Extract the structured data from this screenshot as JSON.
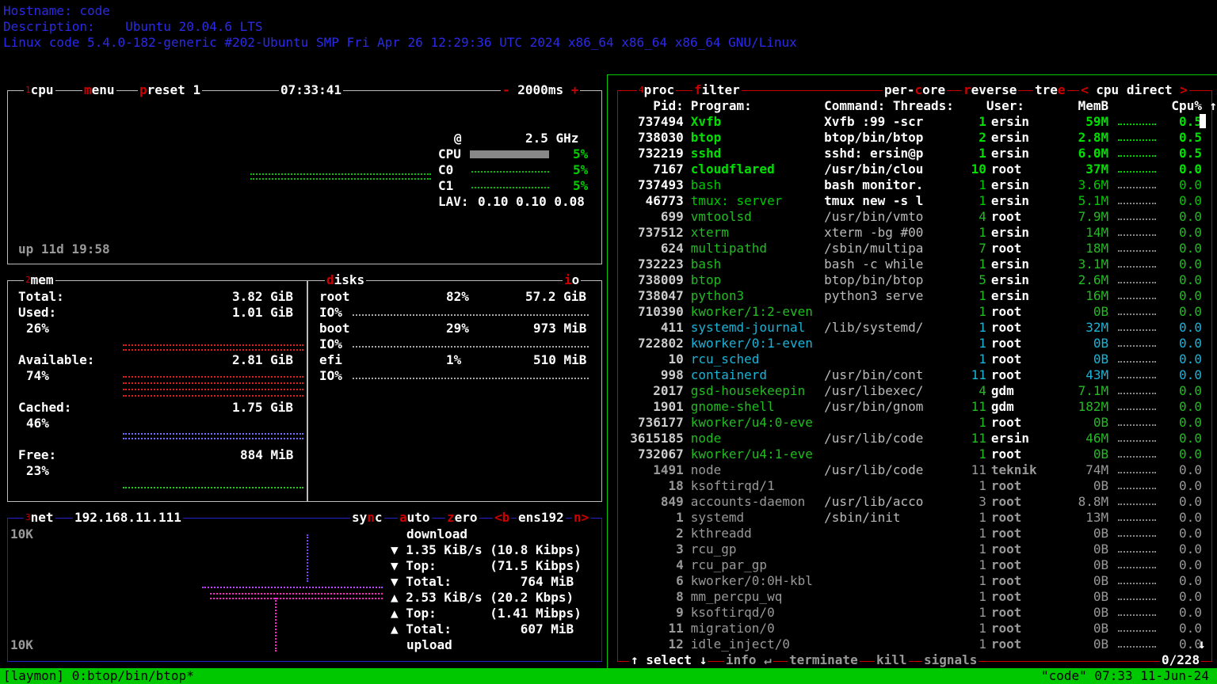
{
  "sysinfo": {
    "hostname": "Hostname: code",
    "description": "Description:    Ubuntu 20.04.6 LTS",
    "uname": "Linux code 5.4.0-182-generic #202-Ubuntu SMP Fri Apr 26 12:29:36 UTC 2024 x86_64 x86_64 x86_64 GNU/Linux"
  },
  "cpu": {
    "num": "1",
    "title": "cpu",
    "menu_key": "m",
    "menu_rest": "enu",
    "preset_key": "p",
    "preset_rest": "reset 1",
    "clock": "07:33:41",
    "minus": "-",
    "interval": "2000ms",
    "plus": "+",
    "freq_at": "@",
    "freq": "2.5 GHz",
    "rows": [
      {
        "label": "CPU",
        "pct": "5%",
        "fill": 1.0
      },
      {
        "label": "C0",
        "pct": "5%"
      },
      {
        "label": "C1",
        "pct": "5%"
      }
    ],
    "lav_label": "LAV:",
    "lav": "0.10 0.10 0.08",
    "uptime": "up 11d 19:58"
  },
  "mem": {
    "num": "2",
    "title": "mem",
    "total_label": "Total:",
    "total": "3.82 GiB",
    "used_label": "Used:",
    "used": "1.01 GiB",
    "used_pct": "26%",
    "avail_label": "Available:",
    "avail": "2.81 GiB",
    "avail_pct": "74%",
    "cached_label": "Cached:",
    "cached": "1.75 GiB",
    "cached_pct": "46%",
    "free_label": "Free:",
    "free": "884 MiB",
    "free_pct": "23%",
    "colors": {
      "used": "#e02020",
      "avail": "#e02020",
      "cached": "#6b6bff",
      "free": "#22cc22"
    }
  },
  "disks": {
    "key": "d",
    "title": "isks",
    "io_key": "i",
    "io_rest": "o",
    "items": [
      {
        "name": "root",
        "pct": "82%",
        "size": "57.2 GiB",
        "io": "IO%"
      },
      {
        "name": "boot",
        "pct": "29%",
        "size": "973 MiB",
        "io": "IO%"
      },
      {
        "name": "efi",
        "pct": "1%",
        "size": "510 MiB",
        "io": "IO%"
      }
    ]
  },
  "net": {
    "num": "3",
    "title": "net",
    "ip": "192.168.11.111",
    "sync_pre": "sy",
    "sync_key": "n",
    "sync_post": "c",
    "auto_key": "a",
    "auto_rest": "uto",
    "zero_key": "z",
    "zero_rest": "ero",
    "b_key": "<b",
    "iface": "ens192",
    "n_key": "n>",
    "scale_top": "10K",
    "scale_bottom": "10K",
    "download": "download",
    "upload": "upload",
    "lines": [
      "▼ 1.35 KiB/s (10.8 Kibps)",
      "▼ Top:       (71.5 Kibps)",
      "▼ Total:         764 MiB",
      "▲ 2.53 KiB/s (20.2 Kbps)",
      "▲ Top:       (1.41 Mibps)",
      "▲ Total:         607 MiB"
    ]
  },
  "proc": {
    "num": "4",
    "title": "proc",
    "filter_key": "f",
    "filter_rest": "ilter",
    "percore_pre": "per-",
    "percore_key": "c",
    "percore_post": "ore",
    "reverse_key": "r",
    "reverse_rest": "everse",
    "tree_pre": "tre",
    "tree_key": "e",
    "sort_left": "<",
    "sort": "cpu direct",
    "sort_right": ">",
    "headers": {
      "pid": "Pid:",
      "program": "Program:",
      "command": "Command:",
      "threads": "Threads:",
      "user": "User:",
      "mem": "MemB",
      "cpu": "Cpu%",
      "arrow_up": "↑",
      "arrow_down": "↓"
    },
    "rows": [
      {
        "pid": "737494",
        "prog": "Xvfb",
        "cmd": "Xvfb :99 -scr",
        "thr": "1",
        "user": "ersin",
        "mem": "59M",
        "cpu": "0.5",
        "style": "hot"
      },
      {
        "pid": "738030",
        "prog": "btop",
        "cmd": "btop/bin/btop",
        "thr": "2",
        "user": "ersin",
        "mem": "2.8M",
        "cpu": "0.5",
        "style": "hot"
      },
      {
        "pid": "732219",
        "prog": "sshd",
        "cmd": "sshd: ersin@p",
        "thr": "1",
        "user": "ersin",
        "mem": "6.0M",
        "cpu": "0.5",
        "style": "hot"
      },
      {
        "pid": "7167",
        "prog": "cloudflared",
        "cmd": "/usr/bin/clou",
        "thr": "10",
        "user": "root",
        "mem": "37M",
        "cpu": "0.0",
        "style": "hot"
      },
      {
        "pid": "737493",
        "prog": "bash",
        "cmd": "bash monitor.",
        "thr": "1",
        "user": "ersin",
        "mem": "3.6M",
        "cpu": "0.0",
        "style": "warm"
      },
      {
        "pid": "46773",
        "prog": "tmux: server",
        "cmd": "tmux new -s l",
        "thr": "1",
        "user": "ersin",
        "mem": "5.1M",
        "cpu": "0.0",
        "style": "warm"
      },
      {
        "pid": "699",
        "prog": "vmtoolsd",
        "cmd": "/usr/bin/vmto",
        "thr": "4",
        "user": "root",
        "mem": "7.9M",
        "cpu": "0.0",
        "style": "green"
      },
      {
        "pid": "737512",
        "prog": "xterm",
        "cmd": "xterm -bg #00",
        "thr": "1",
        "user": "ersin",
        "mem": "14M",
        "cpu": "0.0",
        "style": "green"
      },
      {
        "pid": "624",
        "prog": "multipathd",
        "cmd": "/sbin/multipa",
        "thr": "7",
        "user": "root",
        "mem": "18M",
        "cpu": "0.0",
        "style": "green"
      },
      {
        "pid": "732223",
        "prog": "bash",
        "cmd": "bash -c while",
        "thr": "1",
        "user": "ersin",
        "mem": "3.1M",
        "cpu": "0.0",
        "style": "green"
      },
      {
        "pid": "738009",
        "prog": "btop",
        "cmd": "btop/bin/btop",
        "thr": "5",
        "user": "ersin",
        "mem": "2.6M",
        "cpu": "0.0",
        "style": "green"
      },
      {
        "pid": "738047",
        "prog": "python3",
        "cmd": "python3 serve",
        "thr": "1",
        "user": "ersin",
        "mem": "16M",
        "cpu": "0.0",
        "style": "green"
      },
      {
        "pid": "710390",
        "prog": "kworker/1:2-even",
        "cmd": "",
        "thr": "1",
        "user": "root",
        "mem": "0B",
        "cpu": "0.0",
        "style": "green"
      },
      {
        "pid": "411",
        "prog": "systemd-journal",
        "cmd": "/lib/systemd/",
        "thr": "1",
        "user": "root",
        "mem": "32M",
        "cpu": "0.0",
        "style": "cyan"
      },
      {
        "pid": "722802",
        "prog": "kworker/0:1-even",
        "cmd": "",
        "thr": "1",
        "user": "root",
        "mem": "0B",
        "cpu": "0.0",
        "style": "cyan"
      },
      {
        "pid": "10",
        "prog": "rcu_sched",
        "cmd": "",
        "thr": "1",
        "user": "root",
        "mem": "0B",
        "cpu": "0.0",
        "style": "cyan"
      },
      {
        "pid": "998",
        "prog": "containerd",
        "cmd": "/usr/bin/cont",
        "thr": "11",
        "user": "root",
        "mem": "43M",
        "cpu": "0.0",
        "style": "cyan"
      },
      {
        "pid": "2017",
        "prog": "gsd-housekeepin",
        "cmd": "/usr/libexec/",
        "thr": "4",
        "user": "gdm",
        "mem": "7.1M",
        "cpu": "0.0",
        "style": "lg"
      },
      {
        "pid": "1901",
        "prog": "gnome-shell",
        "cmd": "/usr/bin/gnom",
        "thr": "11",
        "user": "gdm",
        "mem": "182M",
        "cpu": "0.0",
        "style": "lg"
      },
      {
        "pid": "736177",
        "prog": "kworker/u4:0-eve",
        "cmd": "",
        "thr": "1",
        "user": "root",
        "mem": "0B",
        "cpu": "0.0",
        "style": "lg"
      },
      {
        "pid": "3615185",
        "prog": "node",
        "cmd": "/usr/lib/code",
        "thr": "11",
        "user": "ersin",
        "mem": "46M",
        "cpu": "0.0",
        "style": "lg"
      },
      {
        "pid": "732067",
        "prog": "kworker/u4:1-eve",
        "cmd": "",
        "thr": "1",
        "user": "root",
        "mem": "0B",
        "cpu": "0.0",
        "style": "lg"
      },
      {
        "pid": "1491",
        "prog": "node",
        "cmd": "/usr/lib/code",
        "thr": "11",
        "user": "teknik",
        "mem": "74M",
        "cpu": "0.0",
        "style": "grey"
      },
      {
        "pid": "18",
        "prog": "ksoftirqd/1",
        "cmd": "",
        "thr": "1",
        "user": "root",
        "mem": "0B",
        "cpu": "0.0",
        "style": "grey"
      },
      {
        "pid": "849",
        "prog": "accounts-daemon",
        "cmd": "/usr/lib/acco",
        "thr": "3",
        "user": "root",
        "mem": "8.8M",
        "cpu": "0.0",
        "style": "grey"
      },
      {
        "pid": "1",
        "prog": "systemd",
        "cmd": "/sbin/init",
        "thr": "1",
        "user": "root",
        "mem": "13M",
        "cpu": "0.0",
        "style": "grey"
      },
      {
        "pid": "2",
        "prog": "kthreadd",
        "cmd": "",
        "thr": "1",
        "user": "root",
        "mem": "0B",
        "cpu": "0.0",
        "style": "grey"
      },
      {
        "pid": "3",
        "prog": "rcu_gp",
        "cmd": "",
        "thr": "1",
        "user": "root",
        "mem": "0B",
        "cpu": "0.0",
        "style": "grey"
      },
      {
        "pid": "4",
        "prog": "rcu_par_gp",
        "cmd": "",
        "thr": "1",
        "user": "root",
        "mem": "0B",
        "cpu": "0.0",
        "style": "grey"
      },
      {
        "pid": "6",
        "prog": "kworker/0:0H-kbl",
        "cmd": "",
        "thr": "1",
        "user": "root",
        "mem": "0B",
        "cpu": "0.0",
        "style": "grey"
      },
      {
        "pid": "8",
        "prog": "mm_percpu_wq",
        "cmd": "",
        "thr": "1",
        "user": "root",
        "mem": "0B",
        "cpu": "0.0",
        "style": "grey"
      },
      {
        "pid": "9",
        "prog": "ksoftirqd/0",
        "cmd": "",
        "thr": "1",
        "user": "root",
        "mem": "0B",
        "cpu": "0.0",
        "style": "grey"
      },
      {
        "pid": "11",
        "prog": "migration/0",
        "cmd": "",
        "thr": "1",
        "user": "root",
        "mem": "0B",
        "cpu": "0.0",
        "style": "grey"
      },
      {
        "pid": "12",
        "prog": "idle_inject/0",
        "cmd": "",
        "thr": "1",
        "user": "root",
        "mem": "0B",
        "cpu": "0.0",
        "style": "grey"
      }
    ],
    "footer": {
      "select": "↑ select ↓",
      "info": "info ↵",
      "terminate": "terminate",
      "kill": "kill",
      "signals": "signals",
      "count": "0/228"
    }
  },
  "statusbar": {
    "left": "[laymon] 0:btop/bin/btop*",
    "right": "\"code\" 07:33 11-Jun-24"
  },
  "colors": {
    "green": "#00d000",
    "cyan": "#1ab3d6",
    "red": "#c00000",
    "blue": "#2a2ae8"
  }
}
